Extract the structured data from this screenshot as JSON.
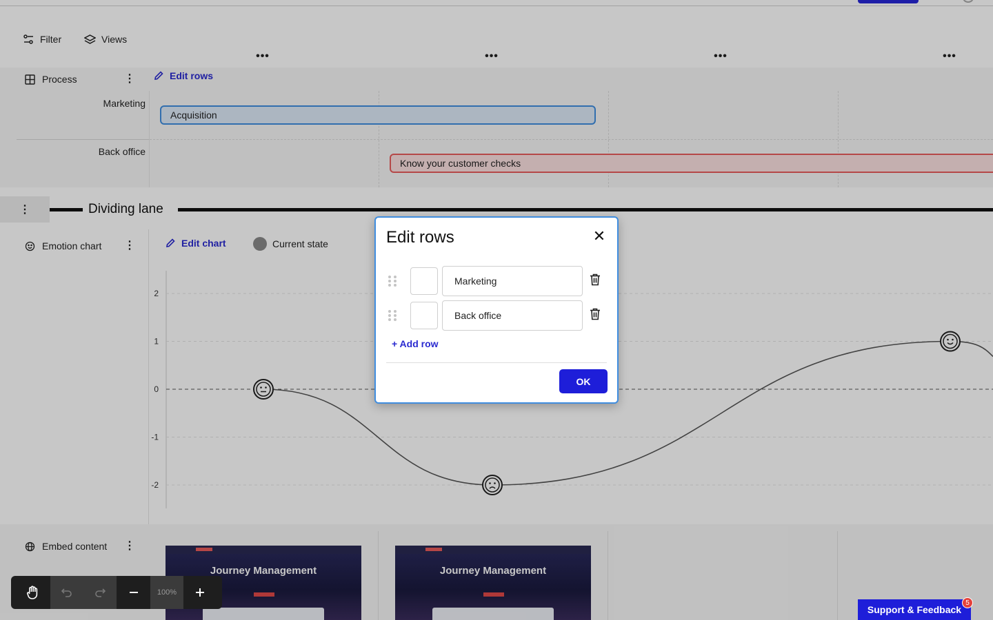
{
  "toolbar": {
    "filter_label": "Filter",
    "views_label": "Views"
  },
  "column_menu_glyph": "•••",
  "process": {
    "lane_title": "Process",
    "edit_label": "Edit rows",
    "rows": [
      {
        "label": "Marketing"
      },
      {
        "label": "Back office"
      }
    ],
    "bars": [
      {
        "text": "Acquisition",
        "color": "#3f8ddf"
      },
      {
        "text": "Know your customer checks",
        "color": "#e85c5c"
      }
    ]
  },
  "divider": {
    "title": "Dividing lane"
  },
  "emotion": {
    "lane_title": "Emotion chart",
    "edit_label": "Edit chart",
    "legend_label": "Current state"
  },
  "chart_data": {
    "type": "line",
    "x": [
      1,
      2,
      3,
      4
    ],
    "series": [
      {
        "name": "Current state",
        "values": [
          0,
          -2,
          null,
          1
        ]
      }
    ],
    "ylim": [
      -2.5,
      2.5
    ],
    "yticks": [
      "2",
      "1",
      "0",
      "-1",
      "-2"
    ],
    "markers": [
      "neutral-face-icon",
      "sad-face-icon",
      "none",
      "happy-face-icon"
    ],
    "baseline_dashed_at": 0
  },
  "embed": {
    "lane_title": "Embed content",
    "cards": [
      {
        "title": "Journey Management"
      },
      {
        "title": "Journey Management"
      }
    ]
  },
  "modal": {
    "title": "Edit rows",
    "rows": [
      {
        "value": "Marketing"
      },
      {
        "value": "Back office"
      }
    ],
    "add_row_label": "+ Add row",
    "ok_label": "OK"
  },
  "bottom_toolbar": {
    "zoom": "100%"
  },
  "support": {
    "label": "Support & Feedback",
    "badge": "5"
  },
  "colors": {
    "accent": "#1e1ed9",
    "modal_border": "#3f8ddf"
  }
}
